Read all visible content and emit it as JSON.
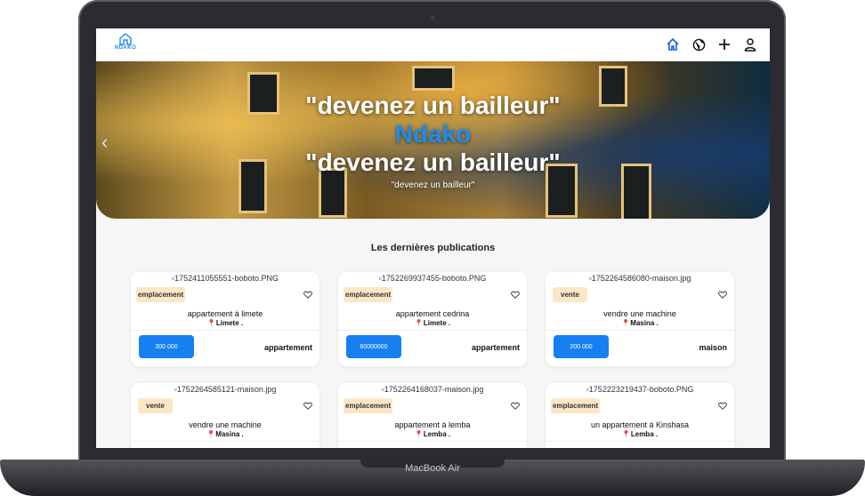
{
  "device": {
    "label": "MacBook Air"
  },
  "app": {
    "logo_text": "NDAKO",
    "nav_icons": [
      "home-icon",
      "globe-icon",
      "plus-icon",
      "user-icon"
    ]
  },
  "hero": {
    "line1": "\"devenez un bailleur\"",
    "brand": "Ndako",
    "line2": "\"devenez un bailleur\"",
    "small": "\"devenez un bailleur\""
  },
  "section_title": "Les dernières publications",
  "cards": [
    {
      "image_alt": "1752411055551-boboto.PNG",
      "badge": "emplacement",
      "title": "appartement à limete",
      "location": "Limete .",
      "price": "300 000",
      "type": "appartement"
    },
    {
      "image_alt": "1752269937455-boboto.PNG",
      "badge": "emplacement",
      "title": "appartement cedrina",
      "location": "Limete .",
      "price": "60000000",
      "type": "appartement"
    },
    {
      "image_alt": "1752264586080-maison.jpg",
      "badge": "vente",
      "title": "vendre une machine",
      "location": "Masina .",
      "price": "200 000",
      "type": "maison"
    },
    {
      "image_alt": "1752264585121-maison.jpg",
      "badge": "vente",
      "title": "vendre une machine",
      "location": "Masina .",
      "price": "",
      "type": ""
    },
    {
      "image_alt": "1752264168037-maison.jpg",
      "badge": "emplacement",
      "title": "appartement à lemba",
      "location": "Lemba .",
      "price": "",
      "type": ""
    },
    {
      "image_alt": "1752223219437-boboto.PNG",
      "badge": "emplacement",
      "title": "un appartement à Kinshasa",
      "location": "Lemba .",
      "price": "",
      "type": ""
    }
  ],
  "colors": {
    "accent": "#1780f0",
    "badge_bg": "#fbe7c6",
    "brand": "#1b8cf2"
  }
}
